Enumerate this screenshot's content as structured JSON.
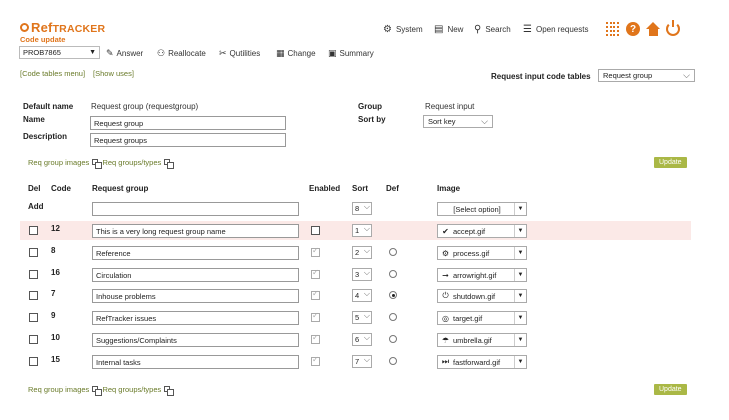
{
  "app": {
    "logo_ref": "Ref",
    "logo_tracker": "TRACKER",
    "subtitle": "Code update"
  },
  "nav": [
    {
      "icon": "⚙",
      "icon_name": "gear-icon",
      "label": "System"
    },
    {
      "icon": "▤",
      "icon_name": "new-icon",
      "label": "New"
    },
    {
      "icon": "⚲",
      "icon_name": "search-icon",
      "label": "Search"
    },
    {
      "icon": "☰",
      "icon_name": "list-icon",
      "label": "Open requests"
    }
  ],
  "toolbar": {
    "request_id": "PROB7865",
    "items": [
      {
        "icon": "✎",
        "icon_name": "answer-icon",
        "label": "Answer"
      },
      {
        "icon": "⚇",
        "icon_name": "reallocate-icon",
        "label": "Reallocate"
      },
      {
        "icon": "✂",
        "icon_name": "qutilities-icon",
        "label": "Qutilities"
      },
      {
        "icon": "▦",
        "icon_name": "change-icon",
        "label": "Change"
      },
      {
        "icon": "▣",
        "icon_name": "summary-icon",
        "label": "Summary"
      }
    ]
  },
  "links": {
    "code_tables_menu": "[Code tables menu]",
    "show_uses": "[Show uses]"
  },
  "request_input_code_tables": {
    "label": "Request input code tables",
    "value": "Request group"
  },
  "form": {
    "default_name_label": "Default name",
    "default_name_value": "Request group (requestgroup)",
    "name_label": "Name",
    "name_value": "Request group",
    "description_label": "Description",
    "description_value": "Request groups",
    "group_label": "Group",
    "group_value": "Request input",
    "sortby_label": "Sort by",
    "sortby_value": "Sort key"
  },
  "sublinks": {
    "images": "Req group images",
    "types": "Req groups/types"
  },
  "update_label": "Update",
  "table": {
    "headers": {
      "del": "Del",
      "code": "Code",
      "group": "Request group",
      "enabled": "Enabled",
      "sort": "Sort",
      "def": "Def",
      "image": "Image"
    },
    "add": {
      "label": "Add",
      "sort": "8",
      "image": "[Select option]"
    },
    "rows": [
      {
        "code": "12",
        "name": "This is a very long request group name",
        "enabled": false,
        "sort": "1",
        "def": null,
        "icon": "✔",
        "icon_name": "check-icon",
        "image": "accept.gif",
        "highlight": true
      },
      {
        "code": "8",
        "name": "Reference",
        "enabled": true,
        "sort": "2",
        "def": false,
        "icon": "⚙",
        "icon_name": "gear-icon",
        "image": "process.gif",
        "highlight": false
      },
      {
        "code": "16",
        "name": "Circulation",
        "enabled": true,
        "sort": "3",
        "def": false,
        "icon": "➞",
        "icon_name": "arrow-right-icon",
        "image": "arrowright.gif",
        "highlight": false
      },
      {
        "code": "7",
        "name": "Inhouse problems",
        "enabled": true,
        "sort": "4",
        "def": true,
        "icon": "⏻",
        "icon_name": "power-icon",
        "image": "shutdown.gif",
        "highlight": false
      },
      {
        "code": "9",
        "name": "RefTracker issues",
        "enabled": true,
        "sort": "5",
        "def": false,
        "icon": "◎",
        "icon_name": "target-icon",
        "image": "target.gif",
        "highlight": false
      },
      {
        "code": "10",
        "name": "Suggestions/Complaints",
        "enabled": true,
        "sort": "6",
        "def": false,
        "icon": "☂",
        "icon_name": "umbrella-icon",
        "image": "umbrella.gif",
        "highlight": false
      },
      {
        "code": "15",
        "name": "Internal tasks",
        "enabled": true,
        "sort": "7",
        "def": false,
        "icon": "⏭",
        "icon_name": "fast-forward-icon",
        "image": "fastforward.gif",
        "highlight": false
      }
    ]
  }
}
